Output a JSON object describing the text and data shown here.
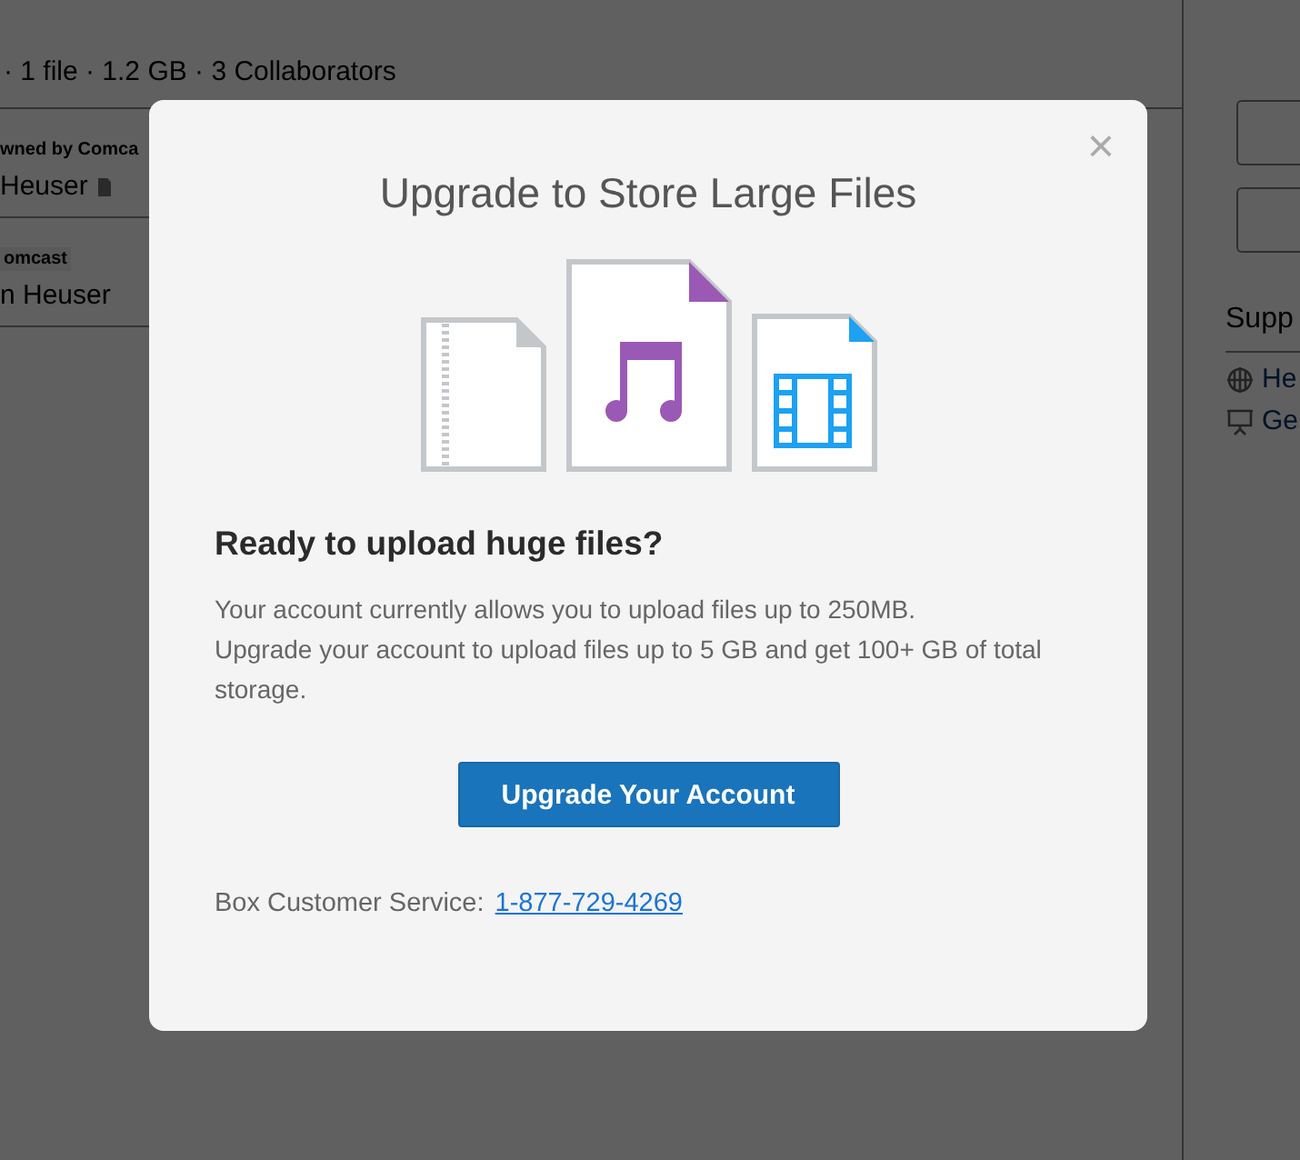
{
  "background": {
    "summary": "· 1 file · 1.2 GB · 3 Collaborators",
    "rows": [
      {
        "tag": "wned by Comca",
        "name": "Heuser"
      },
      {
        "tag": "omcast",
        "name": "n Heuser"
      }
    ],
    "sidebar": {
      "heading": "Supp",
      "links": [
        "He",
        "Ge"
      ]
    }
  },
  "dialog": {
    "close": "×",
    "title": "Upgrade to Store Large Files",
    "heading": "Ready to upload huge files?",
    "body": [
      "Your account currently allows you to upload files up to 250MB.",
      "Upgrade your account to upload files up to 5 GB and get 100+ GB of total storage."
    ],
    "button": "Upgrade Your Account",
    "footer_label": "Box Customer Service:",
    "phone": "1-877-729-4269"
  }
}
